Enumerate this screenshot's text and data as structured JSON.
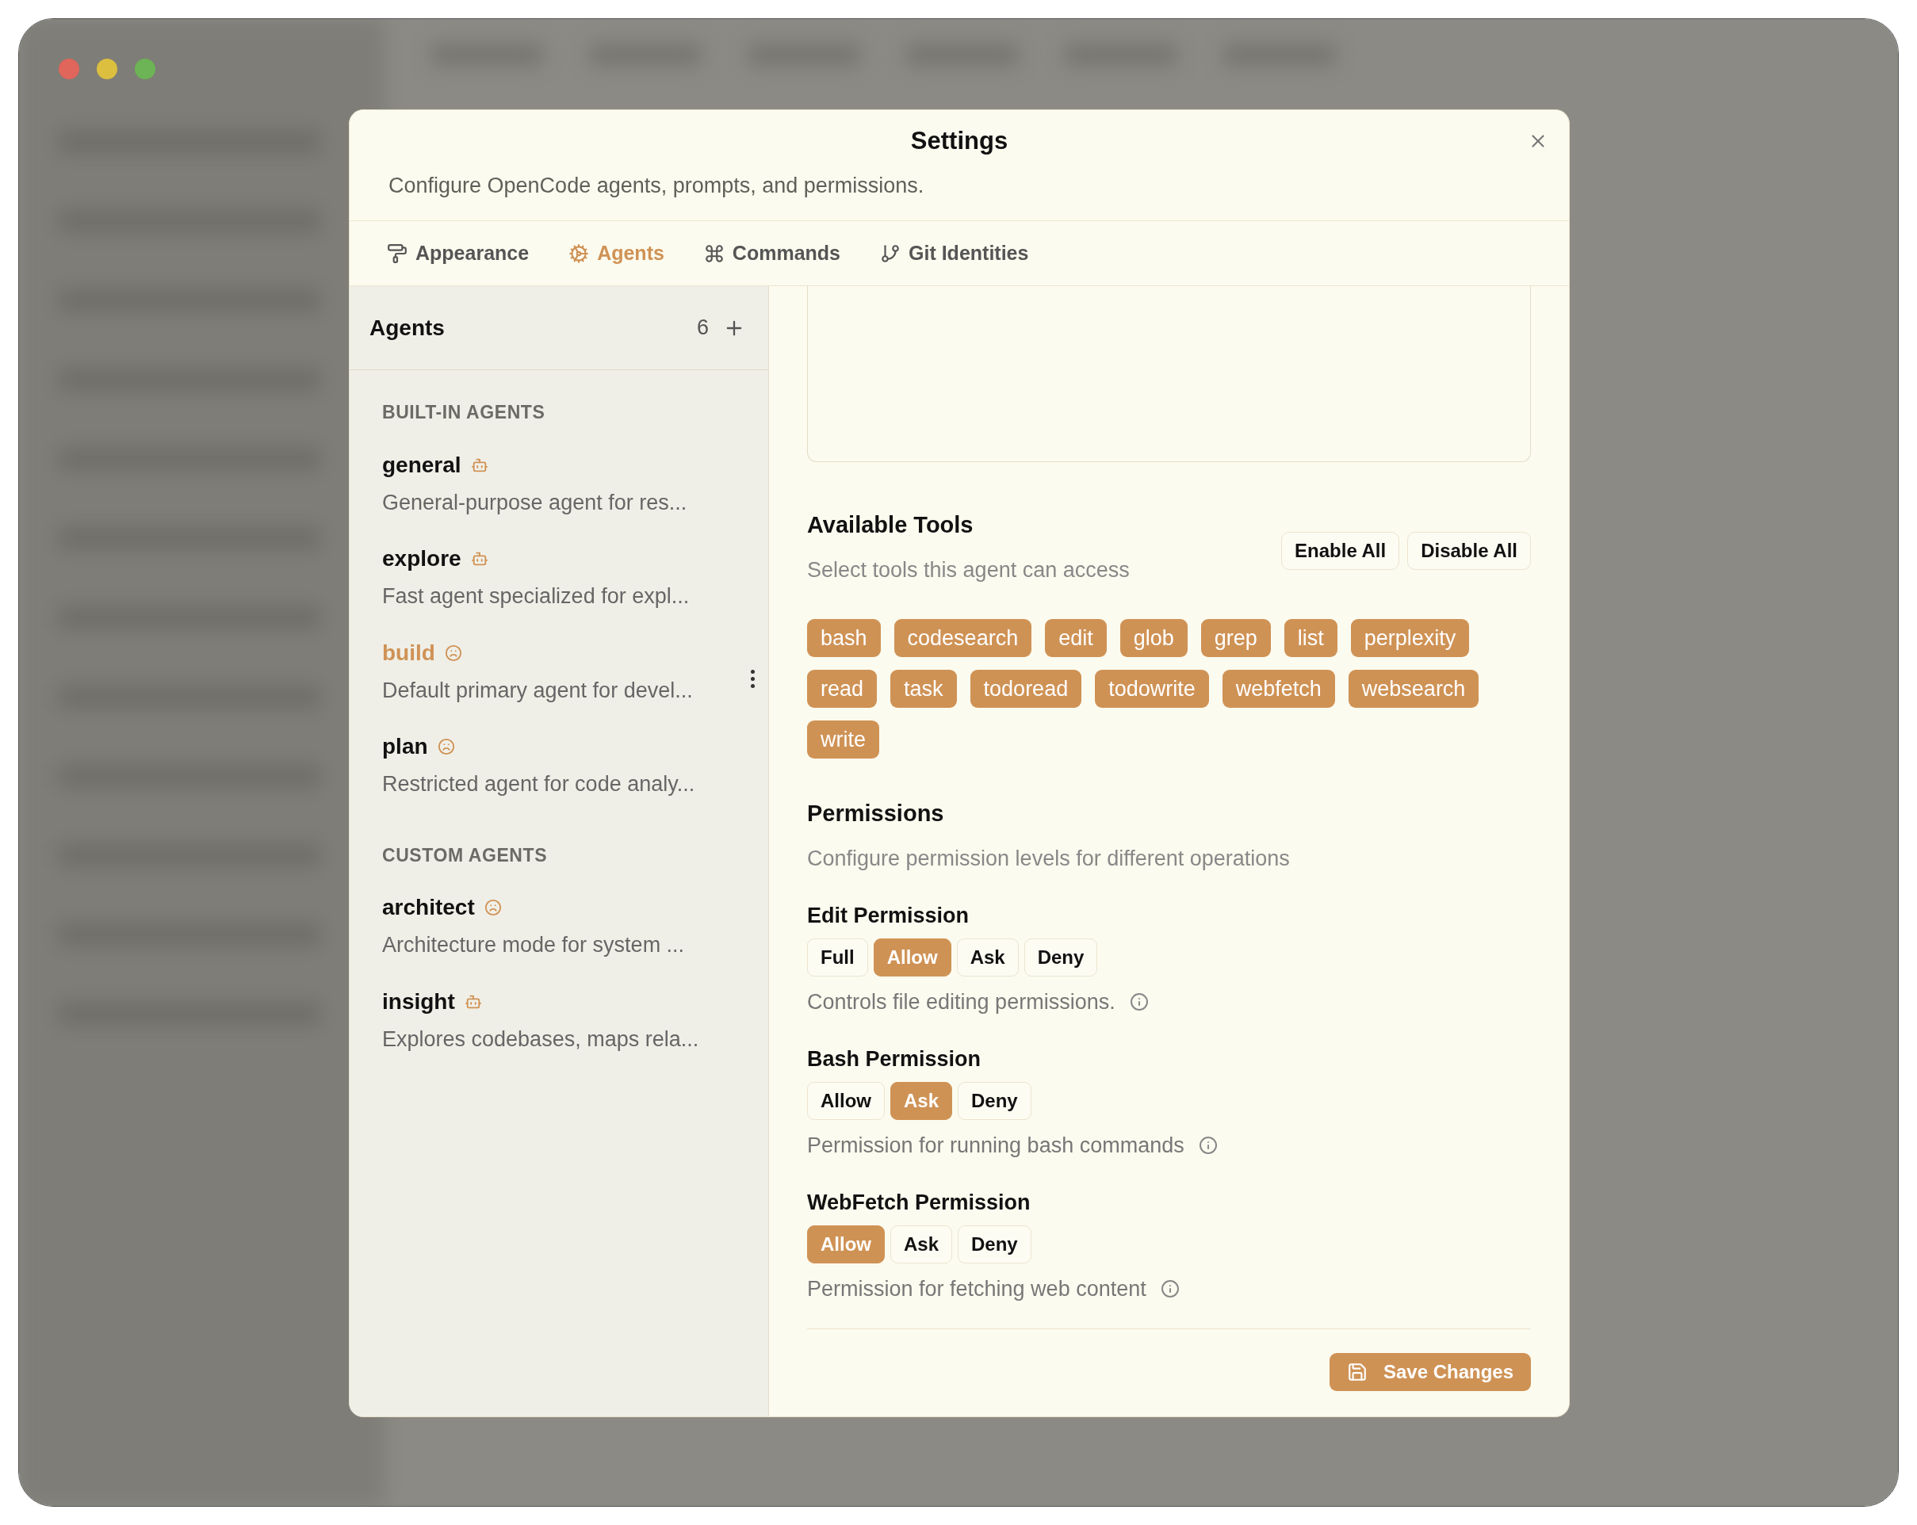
{
  "dialog": {
    "title": "Settings",
    "description": "Configure OpenCode agents, prompts, and permissions."
  },
  "tabs": [
    {
      "label": "Appearance",
      "kind": "appearance",
      "selected": false
    },
    {
      "label": "Agents",
      "kind": "agents",
      "selected": true
    },
    {
      "label": "Commands",
      "kind": "commands",
      "selected": false
    },
    {
      "label": "Git Identities",
      "kind": "git",
      "selected": false
    }
  ],
  "sidebar": {
    "title": "Agents",
    "count": "6",
    "sections": [
      {
        "heading": "BUILT-IN AGENTS",
        "agents": [
          {
            "name": "general",
            "kind": "subagent",
            "description": "General-purpose agent for res...",
            "selected": false
          },
          {
            "name": "explore",
            "kind": "subagent",
            "description": "Fast agent specialized for expl...",
            "selected": false
          },
          {
            "name": "build",
            "kind": "primary",
            "description": "Default primary agent for devel...",
            "selected": true
          },
          {
            "name": "plan",
            "kind": "primary",
            "description": "Restricted agent for code analy...",
            "selected": false
          }
        ]
      },
      {
        "heading": "CUSTOM AGENTS",
        "agents": [
          {
            "name": "architect",
            "kind": "primary",
            "description": "Architecture mode for system ...",
            "selected": false
          },
          {
            "name": "insight",
            "kind": "subagent",
            "description": "Explores codebases, maps rela...",
            "selected": false
          }
        ]
      }
    ]
  },
  "tools": {
    "title": "Available Tools",
    "subtitle": "Select tools this agent can access",
    "buttons": [
      "Enable All",
      "Disable All"
    ],
    "items": [
      {
        "label": "bash",
        "enabled": true
      },
      {
        "label": "codesearch",
        "enabled": true
      },
      {
        "label": "edit",
        "enabled": true
      },
      {
        "label": "glob",
        "enabled": true
      },
      {
        "label": "grep",
        "enabled": true
      },
      {
        "label": "list",
        "enabled": true
      },
      {
        "label": "perplexity",
        "enabled": true
      },
      {
        "label": "read",
        "enabled": true
      },
      {
        "label": "task",
        "enabled": true
      },
      {
        "label": "todoread",
        "enabled": true
      },
      {
        "label": "todowrite",
        "enabled": true
      },
      {
        "label": "webfetch",
        "enabled": true
      },
      {
        "label": "websearch",
        "enabled": true
      },
      {
        "label": "write",
        "enabled": true
      }
    ]
  },
  "permissions": {
    "title": "Permissions",
    "subtitle": "Configure permission levels for different operations",
    "groups": [
      {
        "label": "Edit Permission",
        "options": [
          {
            "label": "Full",
            "selected": false
          },
          {
            "label": "Allow",
            "selected": true
          },
          {
            "label": "Ask",
            "selected": false
          },
          {
            "label": "Deny",
            "selected": false
          }
        ],
        "help": "Controls file editing permissions."
      },
      {
        "label": "Bash Permission",
        "options": [
          {
            "label": "Allow",
            "selected": false
          },
          {
            "label": "Ask",
            "selected": true
          },
          {
            "label": "Deny",
            "selected": false
          }
        ],
        "help": "Permission for running bash commands"
      },
      {
        "label": "WebFetch Permission",
        "options": [
          {
            "label": "Allow",
            "selected": true
          },
          {
            "label": "Ask",
            "selected": false
          },
          {
            "label": "Deny",
            "selected": false
          }
        ],
        "help": "Permission for fetching web content"
      }
    ]
  },
  "save_button": "Save Changes"
}
